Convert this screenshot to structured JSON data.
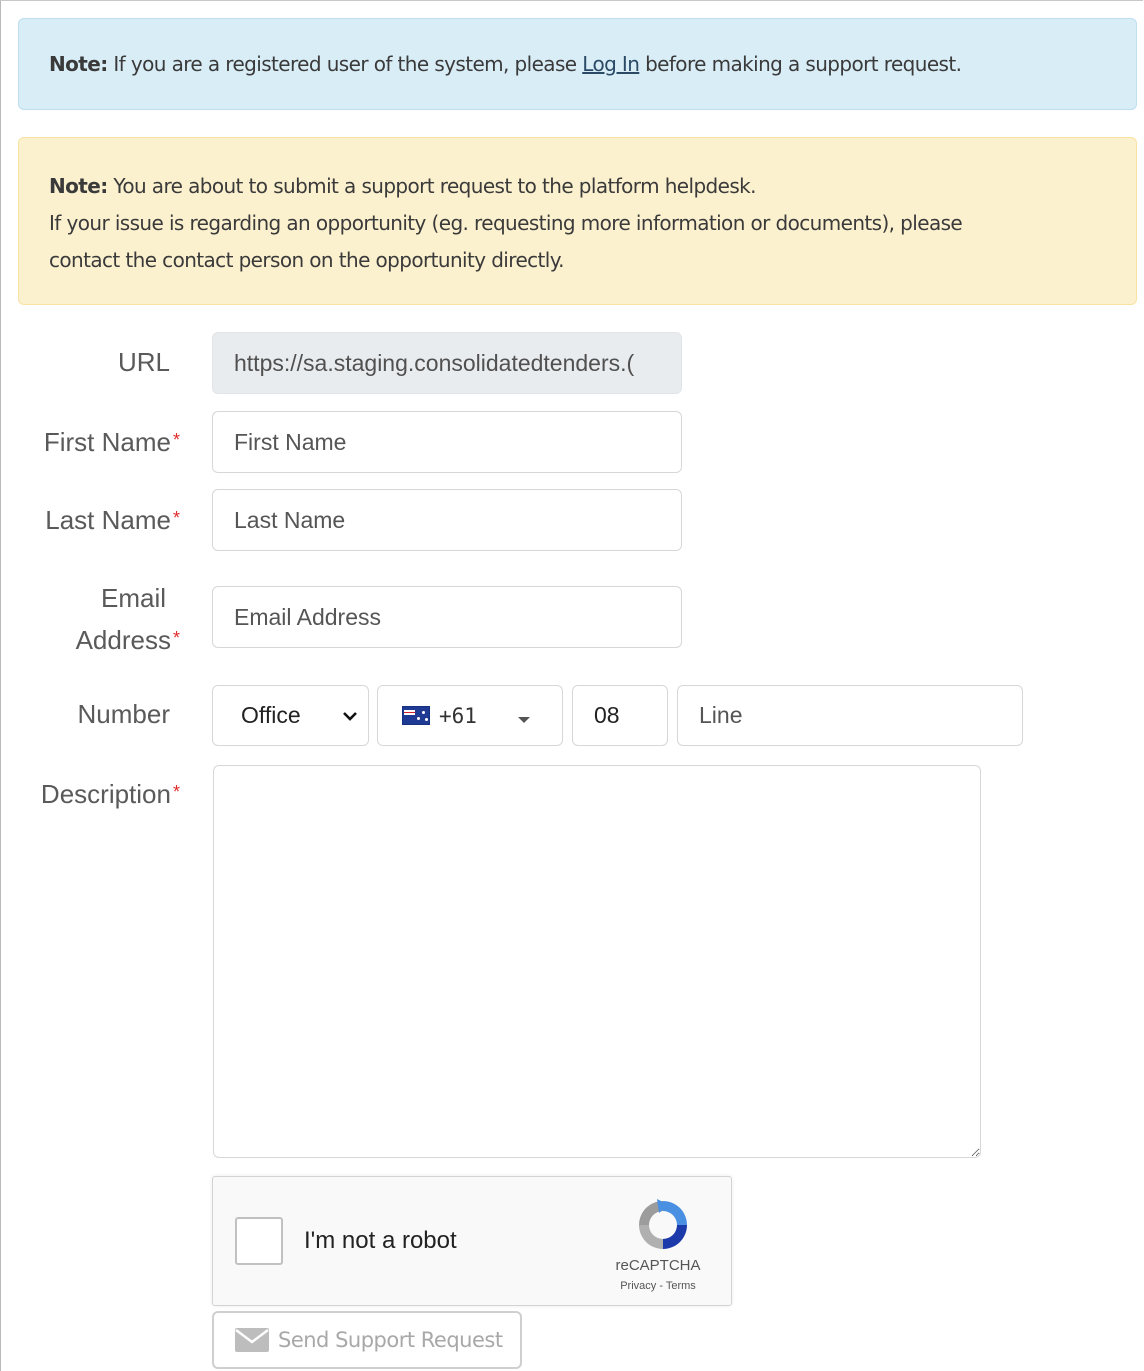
{
  "alerts": {
    "info": {
      "prefix": "Note:",
      "text_before": " If you are a registered user of the system, please ",
      "link": "Log In",
      "text_after": " before making a support request."
    },
    "warning": {
      "prefix": "Note:",
      "line1": " You are about to submit a support request to the platform helpdesk.",
      "line2": "If your issue is regarding an opportunity (eg. requesting more information or documents), please",
      "line3": "contact the contact person on the opportunity directly."
    }
  },
  "form": {
    "url": {
      "label": "URL",
      "value": "https://sa.staging.consolidatedtenders.("
    },
    "first_name": {
      "label": "First Name",
      "placeholder": "First Name"
    },
    "last_name": {
      "label": "Last Name",
      "placeholder": "Last Name"
    },
    "email": {
      "label_line1": "Email",
      "label_line2": "Address",
      "placeholder": "Email Address"
    },
    "number": {
      "label": "Number",
      "type_selected": "Office",
      "country_code": "+61",
      "area_code": "08",
      "line_placeholder": "Line"
    },
    "description": {
      "label": "Description"
    },
    "required_marker": "*"
  },
  "recaptcha": {
    "label": "I'm not a robot",
    "brand": "reCAPTCHA",
    "terms": "Privacy - Terms"
  },
  "submit": {
    "label": "Send Support Request"
  },
  "colors": {
    "info_bg": "#d9edf7",
    "warning_bg": "#fcf1cf",
    "required": "#e02b2b"
  },
  "icons": {
    "select_arrow": "chevron-down-icon",
    "country_flag": "australia-flag-icon",
    "dropdown": "caret-down-icon",
    "recaptcha": "recaptcha-logo-icon",
    "send": "envelope-icon"
  }
}
